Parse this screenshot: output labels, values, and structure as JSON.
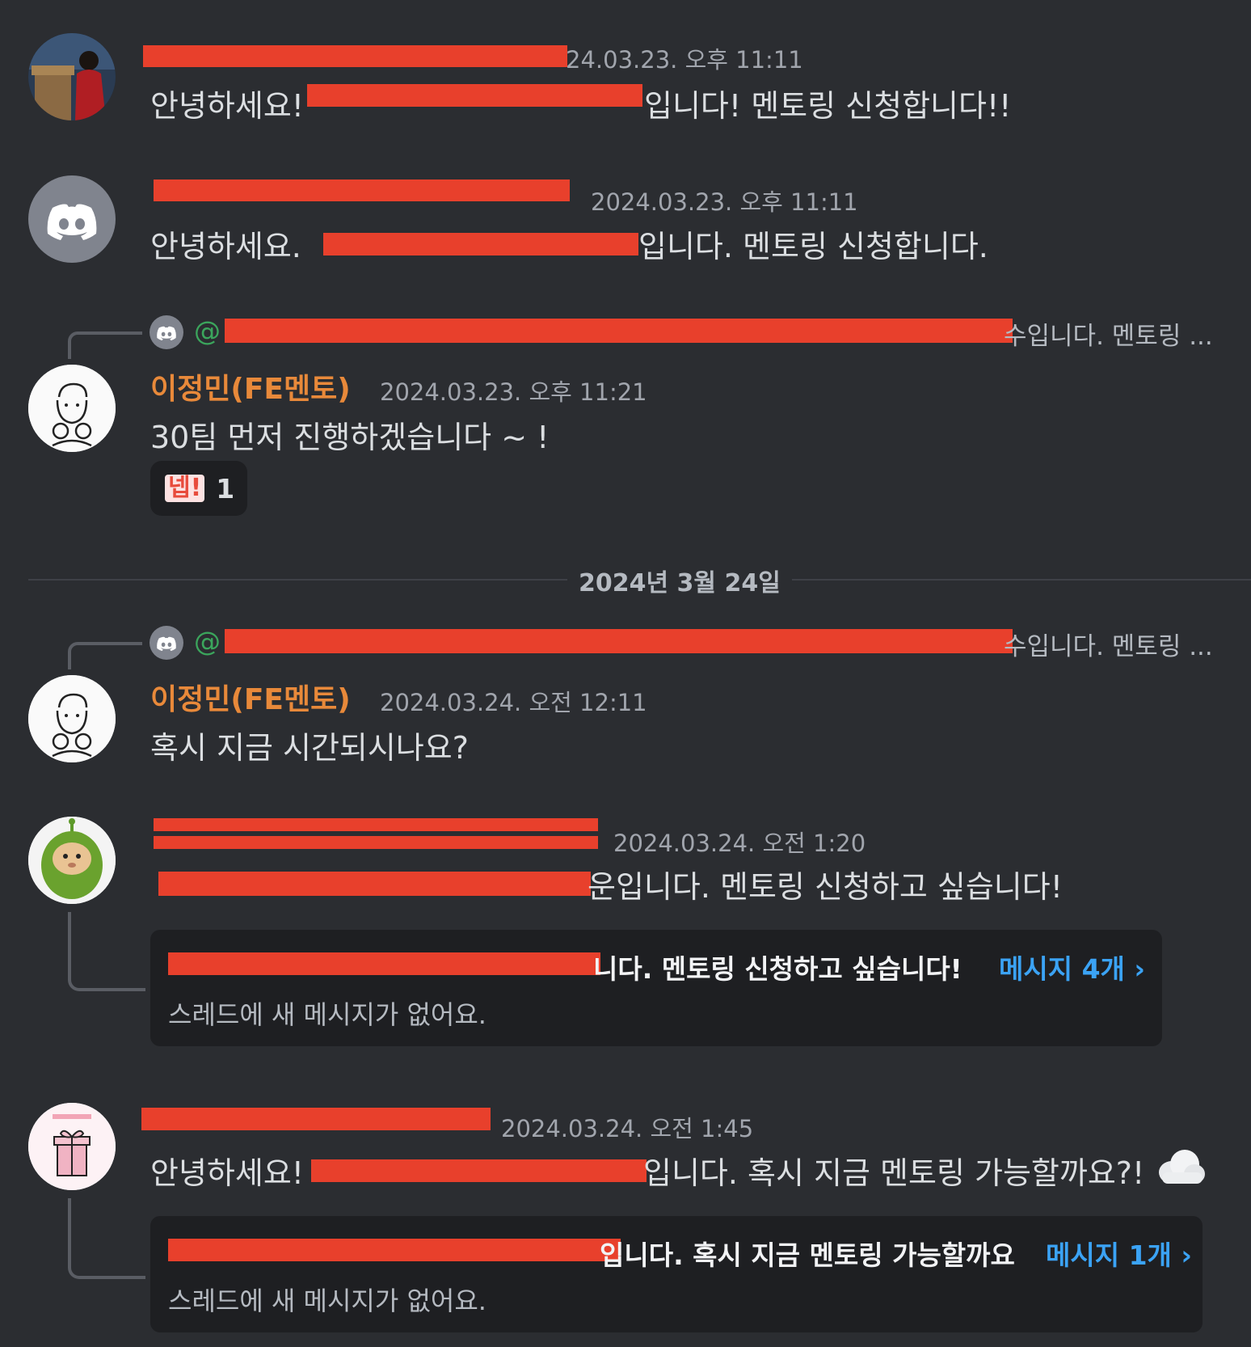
{
  "messages": [
    {
      "timestamp": "24.03.23. 오후 11:11",
      "text": "안녕하세요!",
      "text_after": "입니다! 멘토링 신청합니다!!"
    },
    {
      "timestamp": "2024.03.23. 오후 11:11",
      "text": "안녕하세요.",
      "text_after": "입니다. 멘토링 신청합니다."
    },
    {
      "reply_mention": "@",
      "reply_preview_tail": "수입니다. 멘토링 ...",
      "author": "이정민(FE멘토)",
      "timestamp": "2024.03.23. 오후 11:21",
      "text": "30팀 먼저 진행하겠습니다 ~ !",
      "reaction": {
        "emoji": "넵!",
        "count": "1"
      }
    },
    {
      "reply_mention": "@",
      "reply_preview_tail": "수입니다. 멘토링 ...",
      "author": "이정민(FE멘토)",
      "timestamp": "2024.03.24. 오전 12:11",
      "text": "혹시 지금 시간되시나요?"
    },
    {
      "timestamp": "2024.03.24. 오전 1:20",
      "text_after": "운입니다. 멘토링 신청하고 싶습니다!",
      "thread": {
        "title_tail": "니다. 멘토링 신청하고 싶습니다!",
        "count": "메시지 4개 ›",
        "status": "스레드에 새 메시지가 없어요."
      }
    },
    {
      "timestamp": "2024.03.24. 오전 1:45",
      "text": "안녕하세요!",
      "text_after": "입니다. 혹시 지금 멘토링 가능할까요?!",
      "thread": {
        "title_tail": "입니다. 혹시 지금 멘토링 가능할까요",
        "count": "메시지 1개 ›",
        "status": "스레드에 새 메시지가 없어요."
      }
    }
  ],
  "date_divider": "2024년 3월 24일",
  "colors": {
    "background": "#2b2d31",
    "mentor_name": "#e8893a",
    "link_blue": "#3ba3f5",
    "redaction": "#e8402c",
    "green_name": "#3ba55c"
  },
  "icons": [
    "discord-icon",
    "cloud-icon",
    "chevron-right-icon"
  ]
}
